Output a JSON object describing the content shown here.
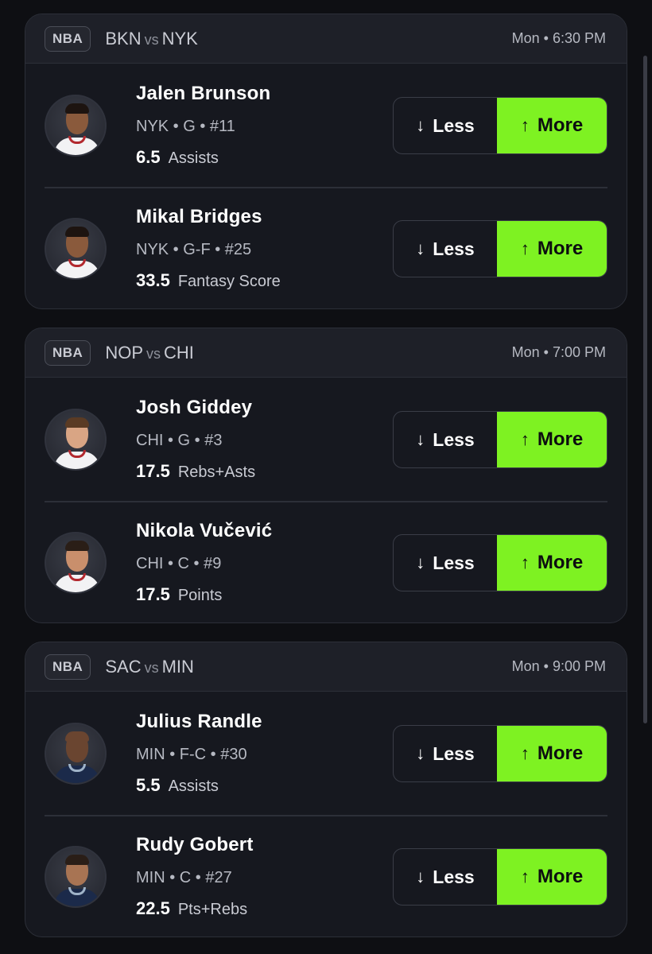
{
  "games": [
    {
      "league": "NBA",
      "away": "BKN",
      "vs": "vs",
      "home": "NYK",
      "time": "Mon • 6:30 PM",
      "players": [
        {
          "name": "Jalen Brunson",
          "meta": "NYK • G • #11",
          "line": "6.5",
          "stat": "Assists"
        },
        {
          "name": "Mikal Bridges",
          "meta": "NYK • G-F • #25",
          "line": "33.5",
          "stat": "Fantasy Score"
        }
      ]
    },
    {
      "league": "NBA",
      "away": "NOP",
      "vs": "vs",
      "home": "CHI",
      "time": "Mon • 7:00 PM",
      "players": [
        {
          "name": "Josh Giddey",
          "meta": "CHI • G • #3",
          "line": "17.5",
          "stat": "Rebs+Asts"
        },
        {
          "name": "Nikola Vučević",
          "meta": "CHI • C • #9",
          "line": "17.5",
          "stat": "Points"
        }
      ]
    },
    {
      "league": "NBA",
      "away": "SAC",
      "vs": "vs",
      "home": "MIN",
      "time": "Mon • 9:00 PM",
      "players": [
        {
          "name": "Julius Randle",
          "meta": "MIN • F-C • #30",
          "line": "5.5",
          "stat": "Assists"
        },
        {
          "name": "Rudy Gobert",
          "meta": "MIN • C • #27",
          "line": "22.5",
          "stat": "Pts+Rebs"
        }
      ]
    }
  ],
  "buttons": {
    "less_label": "Less",
    "more_label": "More",
    "less_icon": "↓",
    "more_icon": "↑",
    "more_color": "#7ef222"
  }
}
